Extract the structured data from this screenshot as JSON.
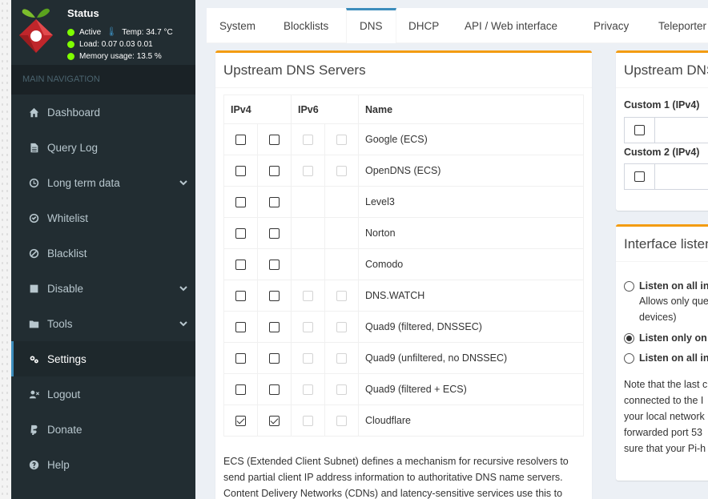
{
  "sidebar": {
    "status_title": "Status",
    "status": {
      "active": "Active",
      "temp": "Temp: 34.7 °C",
      "load": "Load:  0.07  0.03  0.01",
      "memory": "Memory usage:  13.5 %"
    },
    "nav_header": "MAIN NAVIGATION",
    "items": [
      {
        "label": "Dashboard",
        "icon": "home-icon"
      },
      {
        "label": "Query Log",
        "icon": "file-icon"
      },
      {
        "label": "Long term data",
        "icon": "clock-icon"
      },
      {
        "label": "Whitelist",
        "icon": "check-circle-icon"
      },
      {
        "label": "Blacklist",
        "icon": "ban-icon"
      },
      {
        "label": "Disable",
        "icon": "stop-icon"
      },
      {
        "label": "Tools",
        "icon": "folder-icon"
      },
      {
        "label": "Settings",
        "icon": "gears-icon"
      },
      {
        "label": "Logout",
        "icon": "user-times-icon"
      },
      {
        "label": "Donate",
        "icon": "paypal-icon"
      },
      {
        "label": "Help",
        "icon": "question-circle-icon"
      }
    ]
  },
  "tabs": [
    "System",
    "Blocklists",
    "DNS",
    "DHCP",
    "API / Web interface",
    "Privacy",
    "Teleporter"
  ],
  "upstream": {
    "title": "Upstream DNS Servers",
    "headers": {
      "ipv4": "IPv4",
      "ipv6": "IPv6",
      "name": "Name"
    },
    "rows": [
      {
        "name": "Google (ECS)",
        "v6": true,
        "checked": false
      },
      {
        "name": "OpenDNS (ECS)",
        "v6": true,
        "checked": false
      },
      {
        "name": "Level3",
        "v6": false,
        "checked": false
      },
      {
        "name": "Norton",
        "v6": false,
        "checked": false
      },
      {
        "name": "Comodo",
        "v6": false,
        "checked": false
      },
      {
        "name": "DNS.WATCH",
        "v6": true,
        "checked": false
      },
      {
        "name": "Quad9 (filtered, DNSSEC)",
        "v6": true,
        "checked": false
      },
      {
        "name": "Quad9 (unfiltered, no DNSSEC)",
        "v6": true,
        "checked": false
      },
      {
        "name": "Quad9 (filtered + ECS)",
        "v6": true,
        "checked": false
      },
      {
        "name": "Cloudflare",
        "v6": true,
        "checked": true
      }
    ],
    "ecs_lines": [
      "ECS (Extended Client Subnet) defines a mechanism for recursive resolvers to",
      "send partial client IP address information to authoritative DNS name servers.",
      "Content Delivery Networks (CDNs) and latency-sensitive services use this to"
    ]
  },
  "custom": {
    "title": "Upstream DNS",
    "custom1": "Custom 1 (IPv4)",
    "custom2": "Custom 2 (IPv4)"
  },
  "interface": {
    "title": "Interface listen",
    "options": [
      {
        "label": "Listen on all in",
        "checked": false
      },
      {
        "label": "Listen only on",
        "checked": true
      },
      {
        "label": "Listen on all in",
        "checked": false
      }
    ],
    "option1_desc": [
      "Allows only que",
      "devices)"
    ],
    "note": [
      "Note that the last c",
      "connected to the I",
      "your local network",
      "forwarded port 53",
      "sure that your Pi-h"
    ]
  }
}
